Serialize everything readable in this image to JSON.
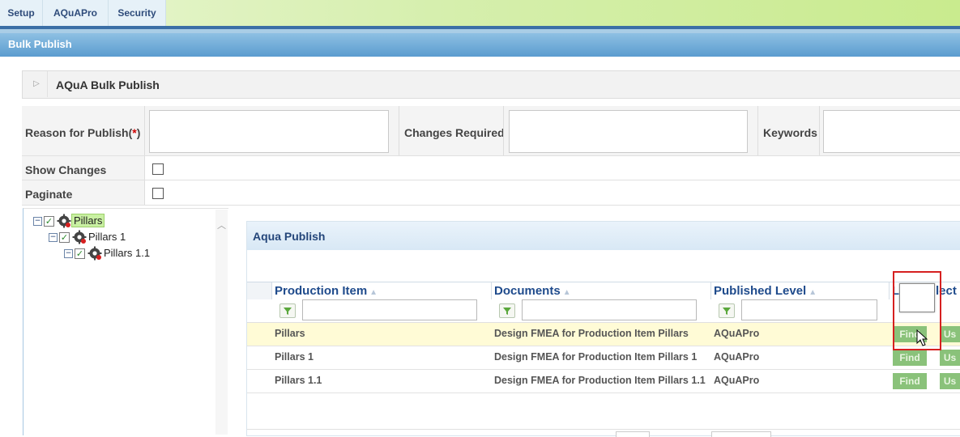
{
  "menu": {
    "items": [
      {
        "label": "Setup"
      },
      {
        "label": "AQuAPro"
      },
      {
        "label": "Security"
      }
    ]
  },
  "page": {
    "title": "Bulk Publish"
  },
  "panel": {
    "title": "AQuA Bulk Publish"
  },
  "form": {
    "reason_label": "Reason for Publish(",
    "reason_req": "*",
    "reason_close": ")",
    "reason_value": "",
    "changes_label": "Changes Required",
    "changes_value": "",
    "keywords_label": "Keywords",
    "keywords_value": "",
    "show_changes_label": "Show Changes",
    "show_changes_checked": false,
    "paginate_label": "Paginate",
    "paginate_checked": false
  },
  "tree": {
    "nodes": [
      {
        "label": "Pillars",
        "checked": true,
        "expanded": true,
        "selected": true
      },
      {
        "label": "Pillars 1",
        "checked": true,
        "expanded": true,
        "selected": false
      },
      {
        "label": "Pillars 1.1",
        "checked": true,
        "expanded": true,
        "selected": false
      }
    ]
  },
  "grid": {
    "title": "Aqua Publish",
    "columns": [
      "Production Item",
      "Documents",
      "Published Level",
      "Le",
      "lect"
    ],
    "filters": [
      "",
      "",
      ""
    ],
    "rows": [
      {
        "production_item": "Pillars",
        "document": "Design FMEA for Production Item Pillars",
        "published_level": "AQuAPro",
        "find": "Find",
        "use": "Us",
        "highlighted": true
      },
      {
        "production_item": "Pillars 1",
        "document": "Design FMEA for Production Item Pillars 1",
        "published_level": "AQuAPro",
        "find": "Find",
        "use": "Us",
        "highlighted": false
      },
      {
        "production_item": "Pillars 1.1",
        "document": "Design FMEA for Production Item Pillars 1.1",
        "published_level": "AQuAPro",
        "find": "Find",
        "use": "Us",
        "highlighted": false
      }
    ]
  },
  "colors": {
    "menu_text": "#2e4b7a",
    "header_blue": "#5b9ccf",
    "column_header": "#1f4b8c",
    "highlight_row": "#fffbd6",
    "button_green": "#8ac27a",
    "annotation_red": "#d62020"
  },
  "icons": [
    "filter-icon",
    "gear-icon",
    "sort-icon",
    "expand-icon",
    "collapse-icon",
    "mouse-cursor-icon"
  ]
}
